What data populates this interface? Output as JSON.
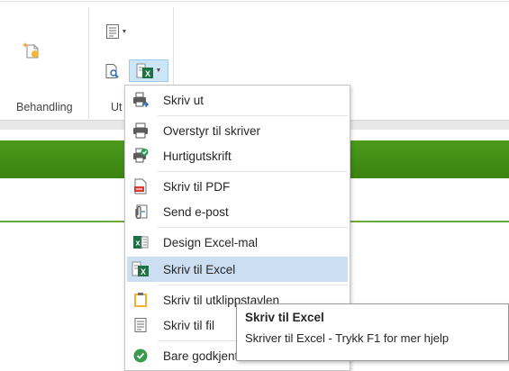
{
  "ribbon": {
    "groups": [
      {
        "label": "Behandling"
      },
      {
        "label": "Ut"
      }
    ]
  },
  "menu": {
    "items": [
      {
        "label": "Skriv ut",
        "icon": "printer-arrow-icon"
      },
      {
        "label": "Overstyr til skriver",
        "icon": "printer-icon"
      },
      {
        "label": "Hurtigutskrift",
        "icon": "quick-print-icon"
      },
      {
        "label": "Skriv til PDF",
        "icon": "pdf-icon"
      },
      {
        "label": "Send e-post",
        "icon": "email-attachment-icon"
      },
      {
        "label": "Design Excel-mal",
        "icon": "excel-design-icon"
      },
      {
        "label": "Skriv til Excel",
        "icon": "excel-export-icon",
        "highlighted": true
      },
      {
        "label": "Skriv til utklippstavlen",
        "icon": "clipboard-icon"
      },
      {
        "label": "Skriv til fil",
        "icon": "file-icon"
      },
      {
        "label": "Bare godkjente",
        "icon": "check-circle-icon"
      }
    ]
  },
  "tooltip": {
    "title": "Skriv til Excel",
    "description": "Skriver til Excel - Trykk F1 for mer hjelp"
  },
  "colors": {
    "green_header": "#3f8a14",
    "menu_highlight": "#ccdff2",
    "excel_green": "#1e7145"
  }
}
